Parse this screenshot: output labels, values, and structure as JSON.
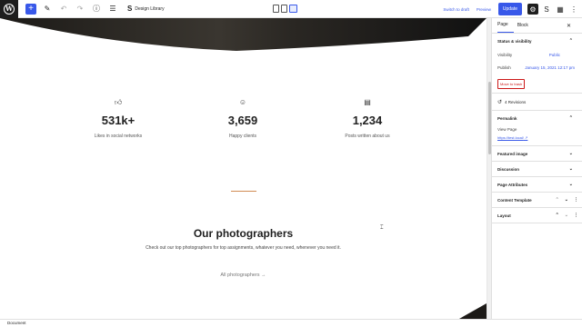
{
  "toolbar": {
    "pattern_label": "Design Library",
    "switch_draft": "Switch to draft",
    "preview": "Preview",
    "update": "Update"
  },
  "stats": [
    {
      "icon": "thumbs-up-icon",
      "value": "531k+",
      "label": "Likes in social networks"
    },
    {
      "icon": "smile-icon",
      "value": "3,659",
      "label": "Happy clients"
    },
    {
      "icon": "document-icon",
      "value": "1,234",
      "label": "Posts written about us"
    }
  ],
  "section": {
    "title": "Our photographers",
    "description": "Check out our top photographers for top assignments, whatever you need, whenever you need it.",
    "link": "All photographers →"
  },
  "sidebar": {
    "tabs": [
      "Page",
      "Block"
    ],
    "status_title": "Status & visibility",
    "visibility_label": "Visibility",
    "visibility_value": "Public",
    "publish_label": "Publish",
    "publish_value": "January 15, 2021 12:17 pm",
    "trash": "Move to trash",
    "revisions": "4 Revisions",
    "permalink_title": "Permalink",
    "view_page": "View Page",
    "url": "https://test.local/",
    "featured_image": "Featured image",
    "discussion": "Discussion",
    "page_attributes": "Page Attributes",
    "content_template": "Content Template",
    "layout": "Layout"
  },
  "status_bar": "Document",
  "colors": {
    "accent": "#3858e9",
    "danger": "#cc1818",
    "divider": "#d18b53"
  }
}
